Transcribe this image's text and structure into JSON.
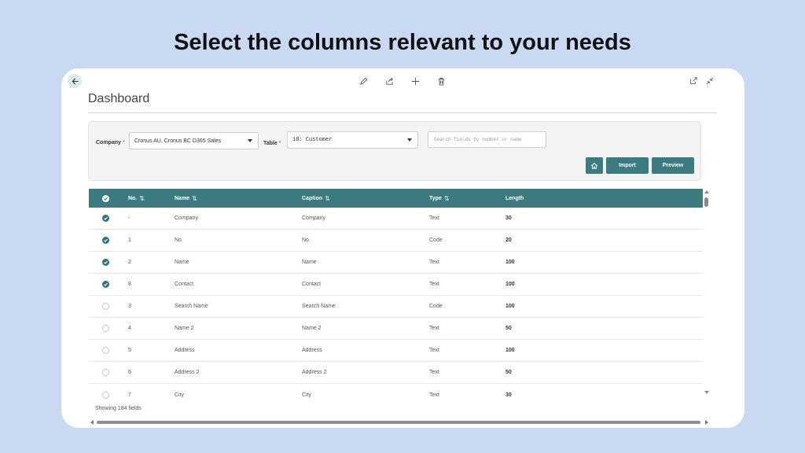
{
  "headline": "Select the columns relevant to your needs",
  "page": {
    "title": "Dashboard"
  },
  "filters": {
    "company_label": "Company",
    "company_value": "Cronus AU, Cronus BC D365 Sales",
    "table_label": "Table",
    "table_value": "18: Customer",
    "required_mark": "*",
    "search_placeholder": "Search fields by number or name"
  },
  "actions": {
    "import_label": "Import",
    "preview_label": "Preview"
  },
  "grid": {
    "columns": [
      "No.",
      "Name",
      "Caption",
      "Type",
      "Length"
    ],
    "sort_glyph": "⇅",
    "rows": [
      {
        "checked": true,
        "no": "-",
        "name": "Company",
        "caption": "Company",
        "type": "Text",
        "length": "30"
      },
      {
        "checked": true,
        "no": "1",
        "name": "No.",
        "caption": "No.",
        "type": "Code",
        "length": "20"
      },
      {
        "checked": true,
        "no": "2",
        "name": "Name",
        "caption": "Name",
        "type": "Text",
        "length": "100"
      },
      {
        "checked": true,
        "no": "8",
        "name": "Contact",
        "caption": "Contact",
        "type": "Text",
        "length": "100"
      },
      {
        "checked": false,
        "no": "3",
        "name": "Search Name",
        "caption": "Search Name",
        "type": "Code",
        "length": "100"
      },
      {
        "checked": false,
        "no": "4",
        "name": "Name 2",
        "caption": "Name 2",
        "type": "Text",
        "length": "50"
      },
      {
        "checked": false,
        "no": "5",
        "name": "Address",
        "caption": "Address",
        "type": "Text",
        "length": "100"
      },
      {
        "checked": false,
        "no": "6",
        "name": "Address 2",
        "caption": "Address 2",
        "type": "Text",
        "length": "50"
      },
      {
        "checked": false,
        "no": "7",
        "name": "City",
        "caption": "City",
        "type": "Text",
        "length": "30"
      }
    ]
  },
  "footer": {
    "count_text": "Showing 184 fields"
  },
  "colors": {
    "accent": "#3a7c80",
    "background": "#c9d9f2",
    "checked": "#2e7379"
  },
  "icons": [
    "back-arrow-icon",
    "edit-pencil-icon",
    "share-icon",
    "add-plus-icon",
    "delete-trash-icon",
    "open-new-window-icon",
    "collapse-icon",
    "home-icon",
    "checkmark-icon"
  ]
}
